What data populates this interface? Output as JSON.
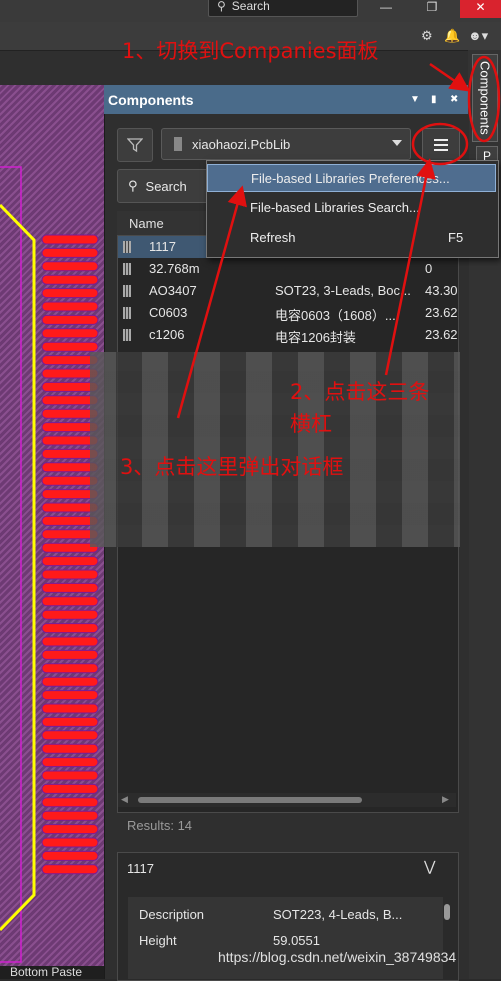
{
  "titlebar": {
    "search_label": "Search",
    "window_buttons": [
      "minimize",
      "restore",
      "close"
    ]
  },
  "pcb": {
    "layer_tab": "Bottom Paste",
    "pad_count": 48
  },
  "side_tabs": {
    "components": "Components",
    "p": "P"
  },
  "panel": {
    "title": "Components",
    "library": "xiaohaozi.PcbLib",
    "search_placeholder": "Search",
    "column_name": "Name",
    "rows": [
      {
        "name": "1117",
        "desc": "",
        "value": ""
      },
      {
        "name": "32.768m",
        "desc": "",
        "value": "0"
      },
      {
        "name": "AO3407",
        "desc": "SOT23, 3-Leads, Boc...",
        "value": "43.30"
      },
      {
        "name": "C0603",
        "desc": "电容0603（1608）...",
        "value": "23.62"
      },
      {
        "name": "c1206",
        "desc": "电容1206封装",
        "value": "23.62"
      }
    ],
    "results": "Results: 14"
  },
  "details": {
    "title": "1117",
    "fields": [
      {
        "label": "Description",
        "value": "SOT223, 4-Leads, B..."
      },
      {
        "label": "Height",
        "value": "59.0551"
      }
    ]
  },
  "dropdown": {
    "items": [
      {
        "label": "File-based Libraries Preferences...",
        "shortcut": ""
      },
      {
        "label": "File-based Libraries Search...",
        "shortcut": ""
      },
      {
        "label": "Refresh",
        "shortcut": "F5"
      }
    ]
  },
  "annotations": {
    "step1": "1、切换到Companies面板",
    "step2_line1": "2、点击这三条",
    "step2_line2": "横杠",
    "step3": "3、点击这里弹出对话框"
  },
  "watermark": "https://blog.csdn.net/weixin_38749834",
  "colors": {
    "panel_header": "#4a6b8a",
    "selection": "#3f5872",
    "annotation": "#e01010",
    "pad": "#ff1a1a",
    "outline": "#ffff00",
    "close_button": "#d9232e"
  }
}
